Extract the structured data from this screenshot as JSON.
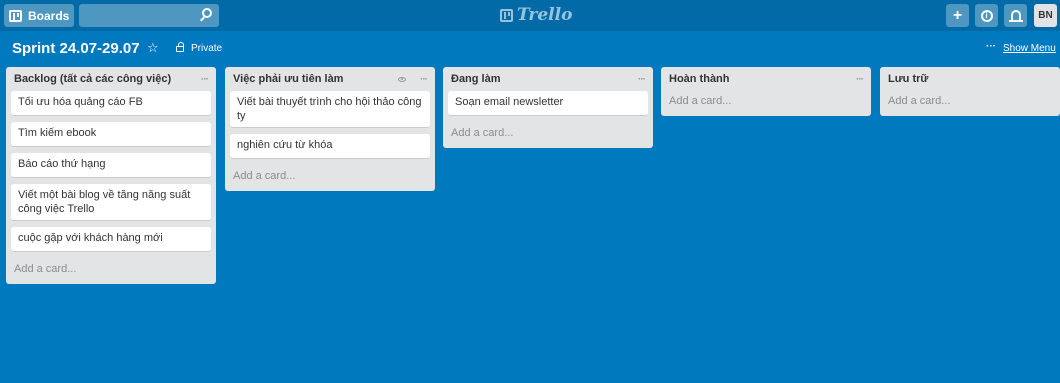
{
  "header": {
    "boards_label": "Boards",
    "search_placeholder": "",
    "logo_text": "Trello",
    "add_label": "+",
    "avatar_initials": "BN"
  },
  "board": {
    "title": "Sprint 24.07-29.07",
    "star": "☆",
    "privacy": "Private",
    "menu_dots": "···",
    "show_menu": "Show Menu"
  },
  "lists": [
    {
      "title": "Backlog (tất cả các công việc)",
      "menu": "···",
      "cards": [
        "Tối ưu hóa quảng cáo FB",
        "Tìm kiếm ebook",
        "Báo cáo thứ hạng",
        "Viết một bài blog về tăng năng suất công việc Trello",
        "cuộc gặp với khách hàng mới"
      ],
      "add_card": "Add a card..."
    },
    {
      "title": "Việc phải ưu tiên làm",
      "menu": "···",
      "cards": [
        "Viết bài thuyết trình cho hội thảo công ty",
        "nghiên cứu từ khóa"
      ],
      "add_card": "Add a card..."
    },
    {
      "title": "Đang làm",
      "menu": "···",
      "cards": [
        "Soạn email newsletter"
      ],
      "add_card": "Add a card..."
    },
    {
      "title": "Hoàn thành",
      "menu": "···",
      "cards": [],
      "add_card": "Add a card..."
    },
    {
      "title": "Lưu trữ",
      "menu": "",
      "cards": [],
      "add_card": "Add a card..."
    }
  ],
  "colors": {
    "board_bg": "#0079bf",
    "header_bg": "#026aa7",
    "list_bg": "#e2e4e6"
  }
}
